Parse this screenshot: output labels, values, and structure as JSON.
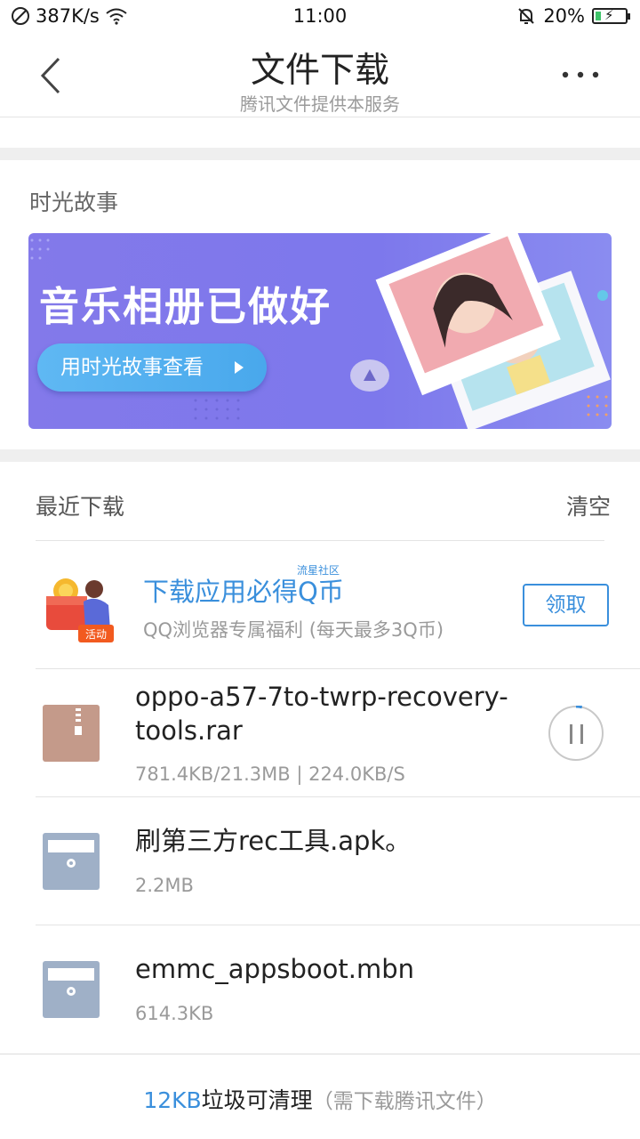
{
  "status_bar": {
    "speed": "387K/s",
    "time": "11:00",
    "battery": "20%",
    "battery_level": 0.2
  },
  "header": {
    "title": "文件下载",
    "subtitle": "腾讯文件提供本服务"
  },
  "story": {
    "title": "时光故事",
    "banner_headline": "音乐相册已做好",
    "banner_cta": "用时光故事查看"
  },
  "recent": {
    "title": "最近下载",
    "clear": "清空"
  },
  "promo": {
    "title": "下载应用必得Q币",
    "superscript": "流星社区",
    "badge": "活动",
    "desc": "QQ浏览器专属福利 (每天最多3Q币)",
    "button": "领取"
  },
  "files": [
    {
      "name_line1": "oppo-a57-7to-twrp-recovery-",
      "name_line2": "tools.rar",
      "meta": "781.4KB/21.3MB | 224.0KB/S",
      "icon": "archive-icon",
      "progress": 0.036
    },
    {
      "name": "刷第三方rec工具.apk。",
      "meta": "2.2MB",
      "icon": "file-box-icon"
    },
    {
      "name": "emmc_appsboot.mbn",
      "meta": "614.3KB",
      "icon": "file-box-icon"
    }
  ],
  "footer": {
    "amount": "12KB",
    "text": "垃圾可清理",
    "note": "（需下载腾讯文件）"
  },
  "colors": {
    "accent": "#3a8fdc",
    "banner": "#7d78ec"
  }
}
